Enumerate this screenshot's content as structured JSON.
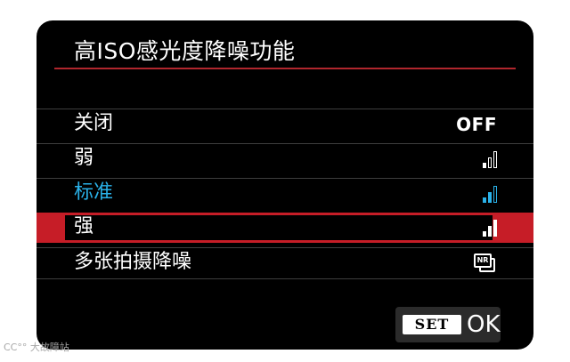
{
  "menu": {
    "title": "高ISO感光度降噪功能",
    "items": [
      {
        "label": "关闭",
        "value_text": "OFF",
        "icon": "off-text",
        "state": "normal"
      },
      {
        "label": "弱",
        "value_text": "",
        "icon": "signal-bars-1-icon",
        "level": 1,
        "state": "normal"
      },
      {
        "label": "标准",
        "value_text": "",
        "icon": "signal-bars-2-icon",
        "level": 2,
        "state": "current"
      },
      {
        "label": "强",
        "value_text": "",
        "icon": "signal-bars-3-icon",
        "level": 3,
        "state": "selected"
      },
      {
        "label": "多张拍摄降噪",
        "value_text": "NR",
        "icon": "multi-shot-nr-icon",
        "state": "normal"
      }
    ]
  },
  "footer": {
    "set_label": "SET",
    "ok_label": "OK"
  },
  "watermark": "CC°° 大故障站",
  "colors": {
    "background": "#000000",
    "accent_red": "#c61d27",
    "current_blue": "#2ab1e8",
    "text": "#ffffff",
    "inactive_bar": "#ffffff"
  }
}
